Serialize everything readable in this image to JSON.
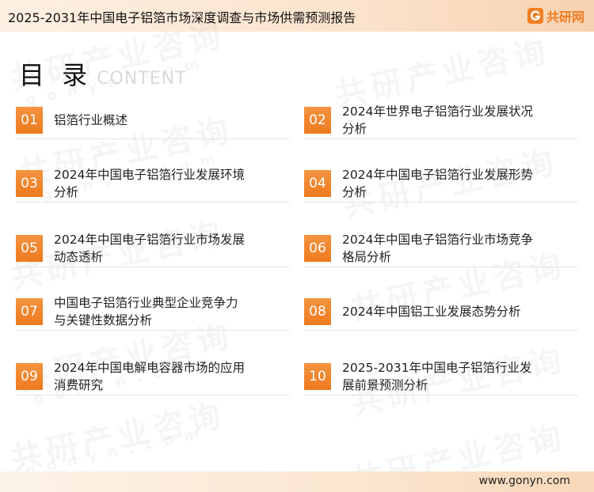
{
  "header": {
    "title": "2025-2031年中国电子铝箔市场深度调查与市场供需预测报告",
    "brand_name": "共研网",
    "brand_icon": "g-logo-icon",
    "brand_color": "#ef7d22"
  },
  "heading": {
    "title_cn": "目 录",
    "title_en": "CONTENT"
  },
  "watermark": {
    "text": "共研产业咨询",
    "url": "gonyn.com"
  },
  "toc": [
    {
      "num": "01",
      "label": "铝箔行业概述"
    },
    {
      "num": "02",
      "label": "2024年世界电子铝箔行业发展状况\n分析"
    },
    {
      "num": "03",
      "label": "2024年中国电子铝箔行业发展环境\n分析"
    },
    {
      "num": "04",
      "label": "2024年中国电子铝箔行业发展形势\n分析"
    },
    {
      "num": "05",
      "label": "2024年中国电子铝箔行业市场发展\n动态透析"
    },
    {
      "num": "06",
      "label": "2024年中国电子铝箔行业市场竞争\n格局分析"
    },
    {
      "num": "07",
      "label": "中国电子铝箔行业典型企业竞争力\n与关键性数据分析"
    },
    {
      "num": "08",
      "label": "2024年中国铝工业发展态势分析"
    },
    {
      "num": "09",
      "label": "2024年中国电解电容器市场的应用\n消费研究"
    },
    {
      "num": "10",
      "label": "2025-2031年中国电子铝箔行业发\n展前景预测分析"
    }
  ],
  "footer": {
    "url": "www.gonyn.com"
  },
  "colors": {
    "accent": "#ef7d22",
    "number_box": "#f08a33"
  }
}
